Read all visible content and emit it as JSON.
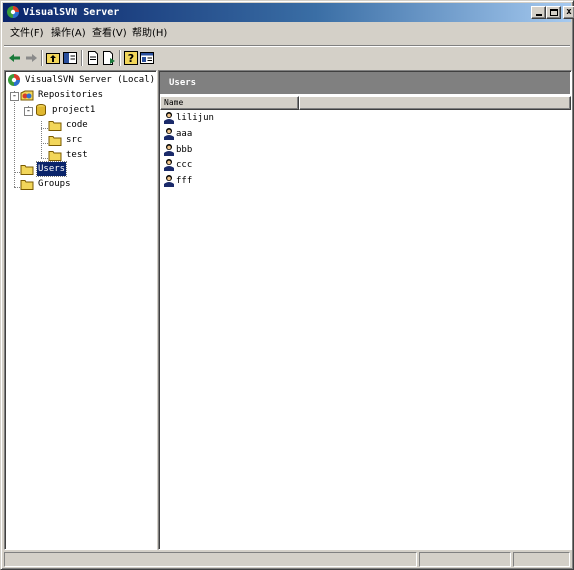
{
  "window": {
    "title": "VisualSVN Server"
  },
  "menu": [
    {
      "label": "文件(F)"
    },
    {
      "label": "操作(A)"
    },
    {
      "label": "查看(V)"
    },
    {
      "label": "帮助(H)"
    }
  ],
  "tree": {
    "root": "VisualSVN Server (Local)",
    "repositories": "Repositories",
    "project": "project1",
    "folders": [
      "code",
      "src",
      "test"
    ],
    "users": "Users",
    "groups": "Groups"
  },
  "right_pane": {
    "header": "Users",
    "column_name": "Name",
    "users": [
      "lilijun",
      "aaa",
      "bbb",
      "ccc",
      "fff"
    ]
  },
  "colors": {
    "title_start": "#0a246a",
    "title_end": "#a6caf0",
    "header_bg": "#808080",
    "selection": "#0a246a"
  },
  "icons": [
    "visualsvn-server-icon",
    "repositories-icon",
    "repository-icon",
    "folder-icon",
    "user-icon",
    "back-arrow-icon",
    "forward-arrow-icon",
    "up-folder-icon",
    "show-hide-tree-icon",
    "properties-icon",
    "export-list-icon",
    "help-icon",
    "console-icon"
  ]
}
